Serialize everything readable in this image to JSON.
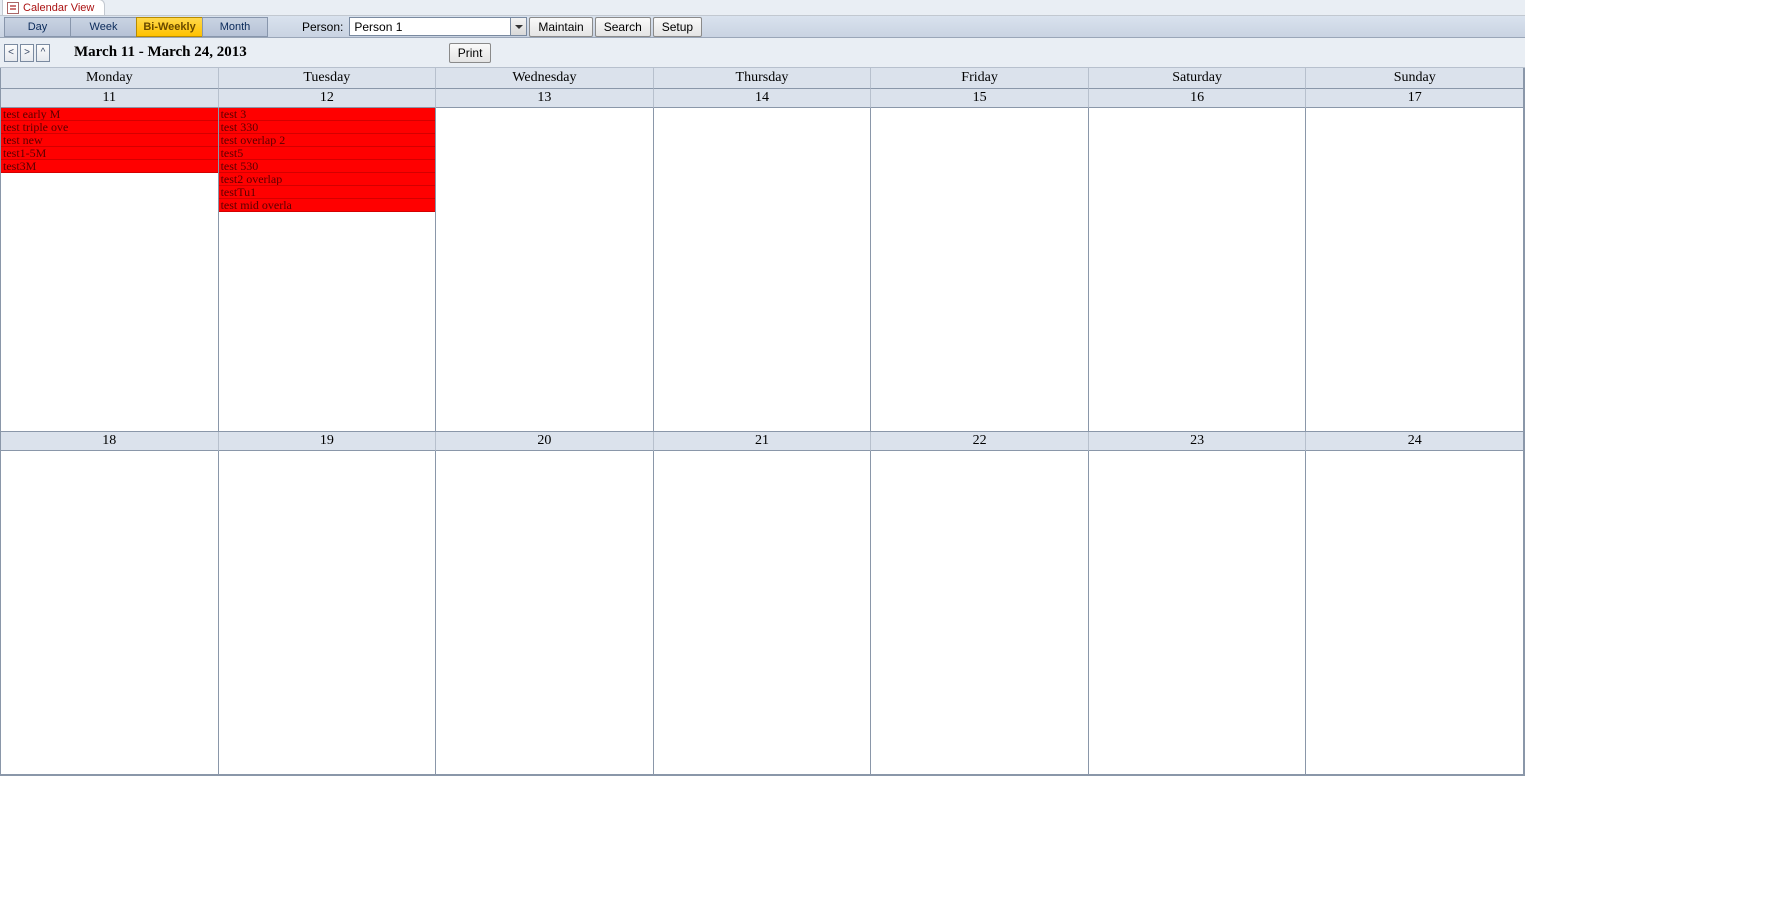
{
  "tab": {
    "title": "Calendar View"
  },
  "views": {
    "items": [
      "Day",
      "Week",
      "Bi-Weekly",
      "Month"
    ],
    "activeIndex": 2
  },
  "personLabel": "Person:",
  "personSelected": "Person 1",
  "buttons": {
    "maintain": "Maintain",
    "search": "Search",
    "setup": "Setup",
    "print": "Print"
  },
  "nav": {
    "prev": "<",
    "next": ">",
    "up": "^"
  },
  "dateRange": "March 11 - March 24, 2013",
  "dayHeaders": [
    "Monday",
    "Tuesday",
    "Wednesday",
    "Thursday",
    "Friday",
    "Saturday",
    "Sunday"
  ],
  "weeks": [
    {
      "dates": [
        "11",
        "12",
        "13",
        "14",
        "15",
        "16",
        "17"
      ],
      "events": [
        [
          "test early M",
          "test triple ove",
          "test new",
          "test1-5M",
          "test3M"
        ],
        [
          "test 3",
          "test 330",
          "test overlap 2",
          "test5",
          "test 530",
          "test2 overlap",
          "testTu1",
          "test mid overla"
        ],
        [],
        [],
        [],
        [],
        []
      ]
    },
    {
      "dates": [
        "18",
        "19",
        "20",
        "21",
        "22",
        "23",
        "24"
      ],
      "events": [
        [],
        [],
        [],
        [],
        [],
        [],
        []
      ]
    }
  ]
}
